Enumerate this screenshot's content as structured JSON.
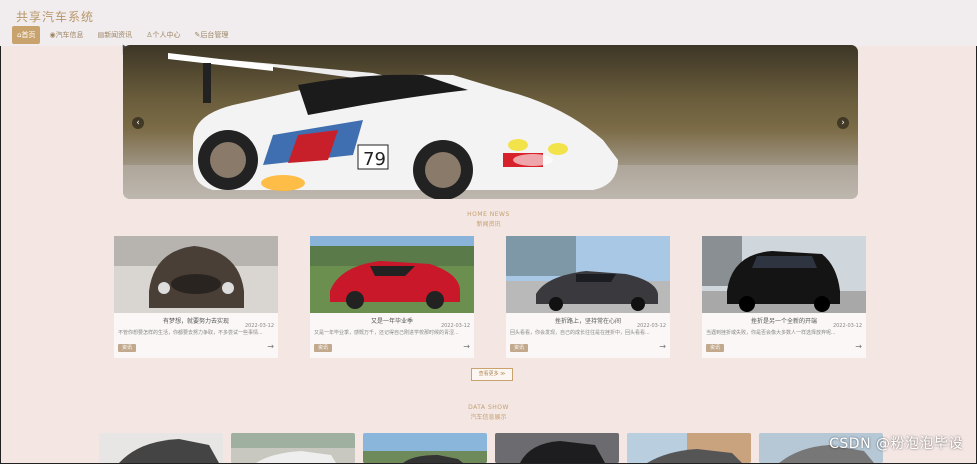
{
  "header": {
    "title": "共享汽车系统",
    "nav": [
      {
        "label": "首页",
        "icon": "home-icon",
        "active": true
      },
      {
        "label": "汽车信息",
        "icon": "car-icon",
        "active": false
      },
      {
        "label": "新闻资讯",
        "icon": "news-icon",
        "active": false
      },
      {
        "label": "个人中心",
        "icon": "user-icon",
        "active": false
      },
      {
        "label": "后台管理",
        "icon": "link-icon",
        "active": false
      }
    ]
  },
  "banner": {
    "prev": "‹",
    "next": "›"
  },
  "news_section": {
    "title_en": "HOME NEWS",
    "title_cn": "新闻资讯",
    "items": [
      {
        "title": "有梦想，就要努力去实现",
        "date": "2022-03-12",
        "desc": "不管你想要怎样的生活，你都要去努力争取，不多尝试一些事情..."
      },
      {
        "title": "又是一年毕业季",
        "date": "2022-03-12",
        "desc": "又是一年毕业季，感慨万千，还记得自己刚进学校那时候的青涩..."
      },
      {
        "title": "挫折路上，坚持常在心间",
        "date": "2022-03-12",
        "desc": "回头看看，你会发现，自己的成长往往是在挫折中，回头看看..."
      },
      {
        "title": "挫折是另一个全新的开端",
        "date": "2022-03-12",
        "desc": "当遇到挫折或失败，你是否会像大多数人一样选择放弃呢..."
      }
    ],
    "tag": "资讯",
    "arrow": "→",
    "more": "查看更多 ≫"
  },
  "show_section": {
    "title_en": "DATA SHOW",
    "title_cn": "汽车信息展示"
  },
  "watermark": "CSDN @粉泡泡毕设"
}
